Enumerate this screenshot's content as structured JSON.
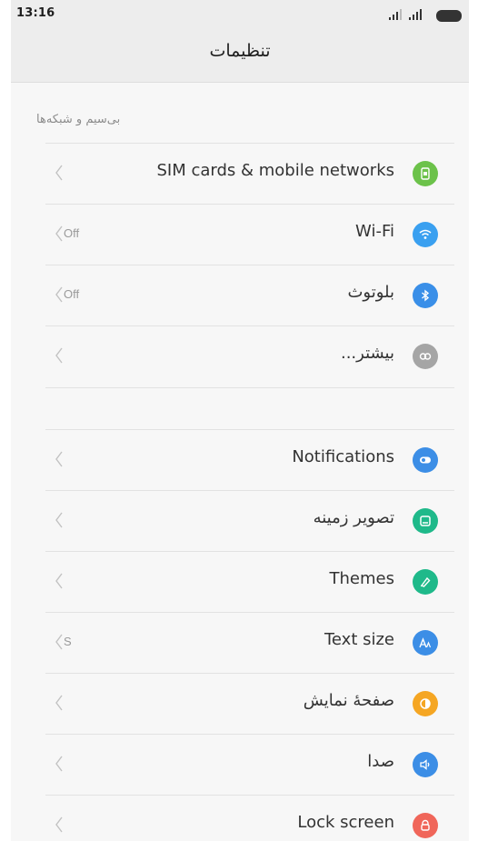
{
  "status": {
    "time": "13:16"
  },
  "header": {
    "title": "تنظیمات"
  },
  "sections": {
    "wireless_title": "بی‌سیم و شبکه‌ها"
  },
  "rows": [
    {
      "label": "SIM cards & mobile networks",
      "value": "",
      "icon": "sim-card-icon",
      "color": "#6cc24a"
    },
    {
      "label": "Wi-Fi",
      "value": "Off",
      "icon": "wifi-icon",
      "color": "#3aa0f0"
    },
    {
      "label": "بلوتوث",
      "value": "Off",
      "icon": "bluetooth-icon",
      "color": "#3a8fe8"
    },
    {
      "label": "بیشتر...",
      "value": "",
      "icon": "more-link-icon",
      "color": "#a5a5a5"
    },
    {
      "label": "Notifications",
      "value": "",
      "icon": "notifications-icon",
      "color": "#3c8ee6"
    },
    {
      "label": "تصویر زمینه",
      "value": "",
      "icon": "wallpaper-icon",
      "color": "#1fb98a"
    },
    {
      "label": "Themes",
      "value": "",
      "icon": "themes-icon",
      "color": "#1fb98a"
    },
    {
      "label": "Text size",
      "value": "S",
      "icon": "text-size-icon",
      "color": "#3c8ee6"
    },
    {
      "label": "صفحهٔ نمایش",
      "value": "",
      "icon": "display-icon",
      "color": "#f5a623"
    },
    {
      "label": "صدا",
      "value": "",
      "icon": "sound-icon",
      "color": "#3c8ee6"
    },
    {
      "label": "Lock screen",
      "value": "",
      "icon": "lock-screen-icon",
      "color": "#f0665a"
    }
  ]
}
